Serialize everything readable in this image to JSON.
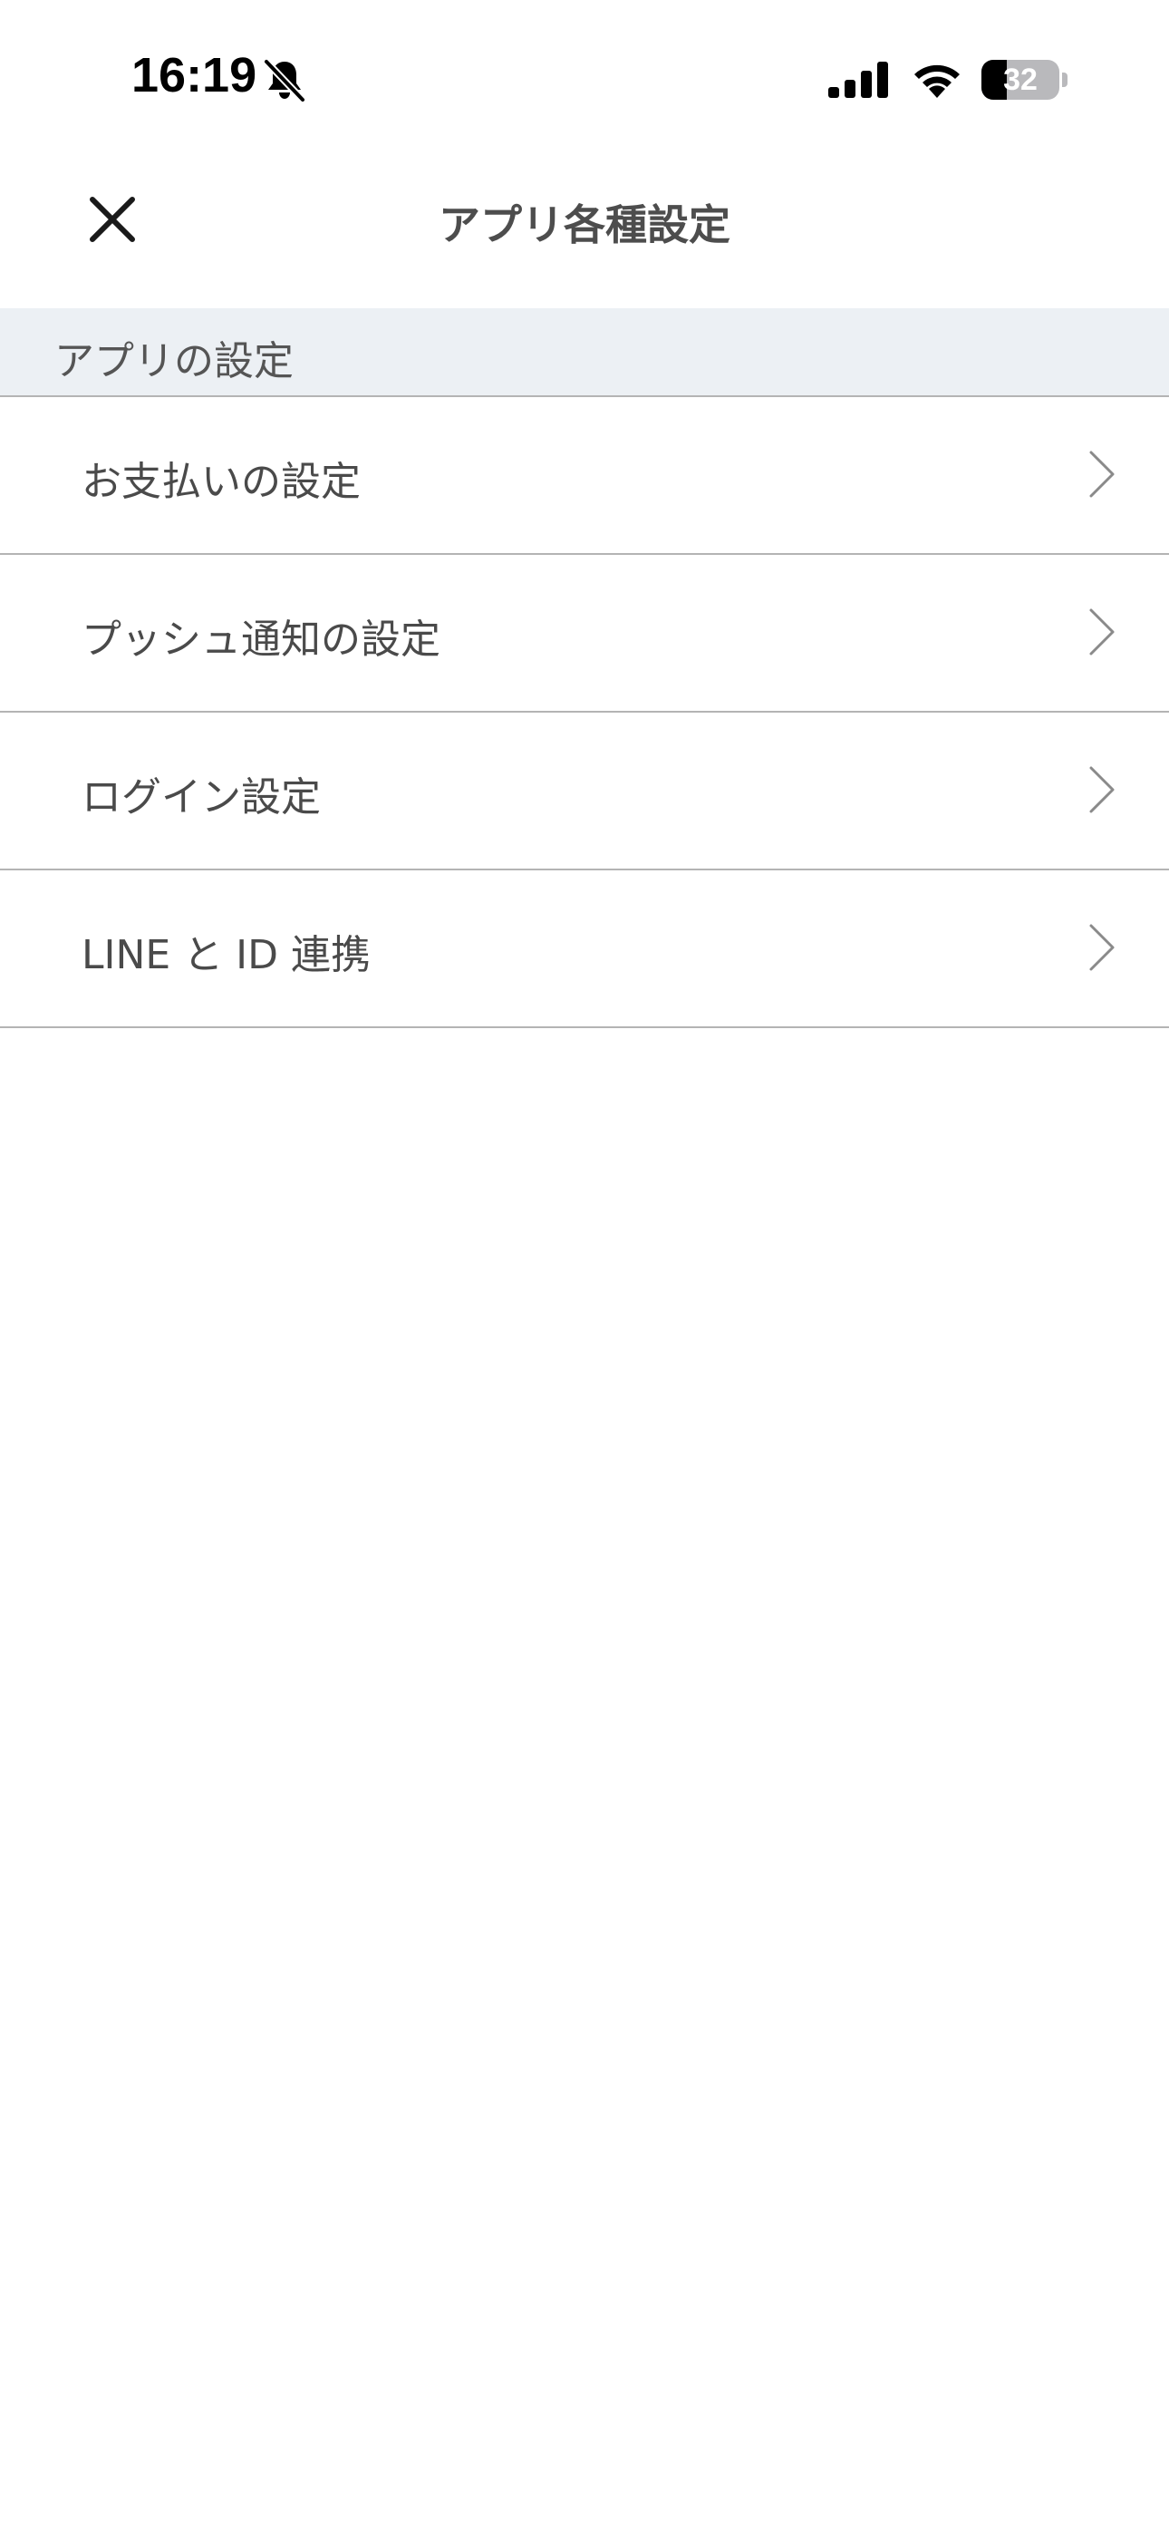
{
  "status_bar": {
    "time": "16:19",
    "battery_level": "32",
    "battery_fraction": 0.32,
    "icons": [
      "bell-slash-icon",
      "cellular-signal-icon",
      "wifi-icon",
      "battery-icon"
    ]
  },
  "header": {
    "title": "アプリ各種設定",
    "close_icon": "close-icon"
  },
  "section": {
    "title": "アプリの設定"
  },
  "items": [
    {
      "label": "お支払いの設定",
      "icon": "chevron-right-icon"
    },
    {
      "label": "プッシュ通知の設定",
      "icon": "chevron-right-icon"
    },
    {
      "label": "ログイン設定",
      "icon": "chevron-right-icon"
    },
    {
      "label": "LINE と ID 連携",
      "icon": "chevron-right-icon"
    }
  ],
  "colors": {
    "section_background": "#ecf0f4",
    "divider": "#b4b4b4",
    "text": "#4a4a4a",
    "chevron": "#8a8a8a"
  }
}
